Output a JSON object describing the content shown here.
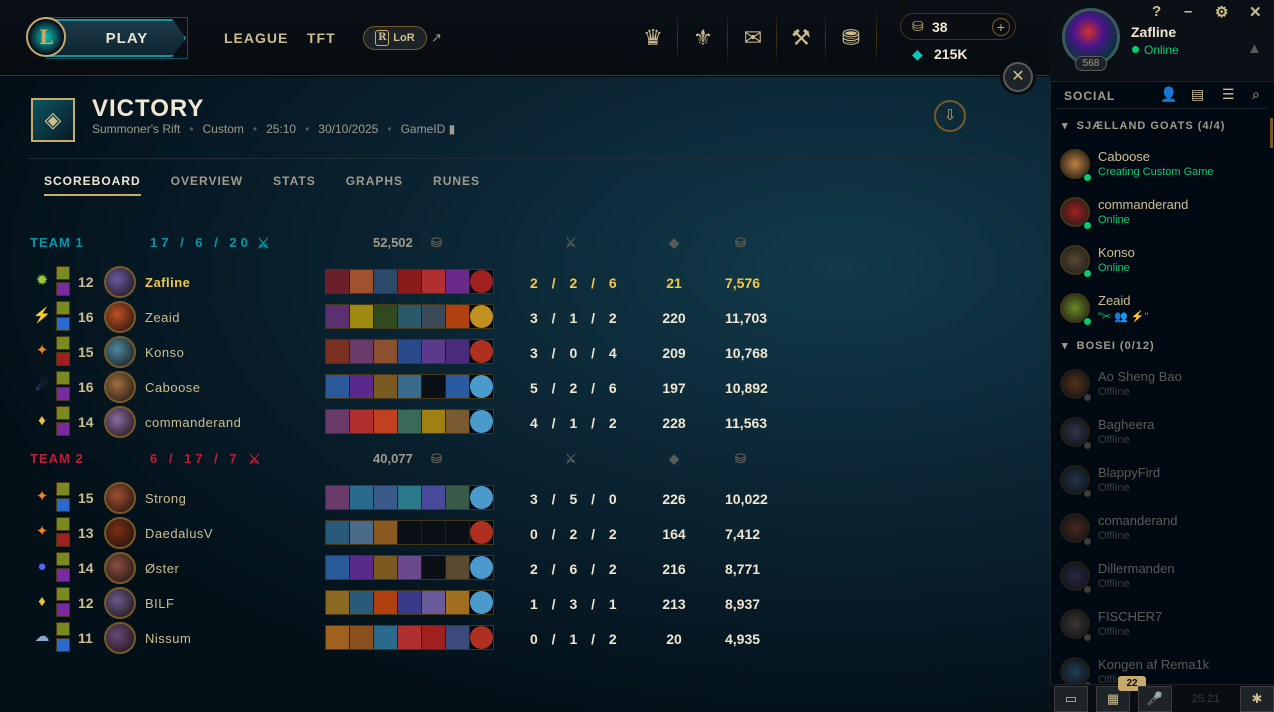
{
  "nav": {
    "play": "PLAY",
    "league": "LEAGUE",
    "tft": "TFT",
    "lor": "LoR",
    "lor_icon": "R",
    "ext": "↗",
    "rp": "38",
    "be": "215K"
  },
  "profile": {
    "name": "Zafline",
    "status": "Online",
    "level": "568"
  },
  "window": {
    "help": "?",
    "minimize": "–",
    "settings": "⚙",
    "close": "✕",
    "bell": "🔔"
  },
  "match": {
    "result": "VICTORY",
    "map": "Summoner's Rift",
    "mode": "Custom",
    "duration": "25:10",
    "date": "30/10/2025",
    "gameid_label": "GameID"
  },
  "tabs": [
    "SCOREBOARD",
    "OVERVIEW",
    "STATS",
    "GRAPHS",
    "RUNES"
  ],
  "team1": {
    "name": "TEAM 1",
    "kda": "17 / 6 / 20",
    "gold": "52,502",
    "color": "#0a96aa"
  },
  "team2": {
    "name": "TEAM 2",
    "kda": "6 / 17 / 7",
    "gold": "40,077",
    "color": "#be1e37"
  },
  "players1": [
    {
      "level": "12",
      "name": "Zafline",
      "kda": "2 / 2 / 6",
      "cs": "21",
      "gold": "7,576",
      "self": true
    },
    {
      "level": "16",
      "name": "Zeaid",
      "kda": "3 / 1 / 2",
      "cs": "220",
      "gold": "11,703"
    },
    {
      "level": "15",
      "name": "Konso",
      "kda": "3 / 0 / 4",
      "cs": "209",
      "gold": "10,768"
    },
    {
      "level": "16",
      "name": "Caboose",
      "kda": "5 / 2 / 6",
      "cs": "197",
      "gold": "10,892"
    },
    {
      "level": "14",
      "name": "commanderand",
      "kda": "4 / 1 / 2",
      "cs": "228",
      "gold": "11,563"
    }
  ],
  "players2": [
    {
      "level": "15",
      "name": "Strong",
      "kda": "3 / 5 / 0",
      "cs": "226",
      "gold": "10,022"
    },
    {
      "level": "13",
      "name": "DaedalusV",
      "kda": "0 / 2 / 2",
      "cs": "164",
      "gold": "7,412"
    },
    {
      "level": "14",
      "name": "Øster",
      "kda": "2 / 6 / 2",
      "cs": "216",
      "gold": "8,771"
    },
    {
      "level": "12",
      "name": "BILF",
      "kda": "1 / 3 / 1",
      "cs": "213",
      "gold": "8,937"
    },
    {
      "level": "11",
      "name": "Nissum",
      "kda": "0 / 1 / 2",
      "cs": "20",
      "gold": "4,935"
    }
  ],
  "social": {
    "title": "SOCIAL",
    "group1": "SJÆLLAND GOATS (4/4)",
    "group2": "BOSEI (0/12)",
    "online": [
      {
        "name": "Caboose",
        "status": "Creating Custom Game"
      },
      {
        "name": "commanderand",
        "status": "Online"
      },
      {
        "name": "Konso",
        "status": "Online"
      },
      {
        "name": "Zeaid",
        "status": "\"✂ 👥 ⚡\""
      }
    ],
    "offline": [
      {
        "name": "Ao Sheng Bao",
        "status": "Offline"
      },
      {
        "name": "Bagheera",
        "status": "Offline"
      },
      {
        "name": "BlappyFird",
        "status": "Offline"
      },
      {
        "name": "comanderand",
        "status": "Offline"
      },
      {
        "name": "Dillermanden",
        "status": "Offline"
      },
      {
        "name": "FISCHER7",
        "status": "Offline"
      },
      {
        "name": "Kongen af Rema1k",
        "status": "Offline"
      }
    ],
    "badge": "22",
    "version": "25.21"
  }
}
